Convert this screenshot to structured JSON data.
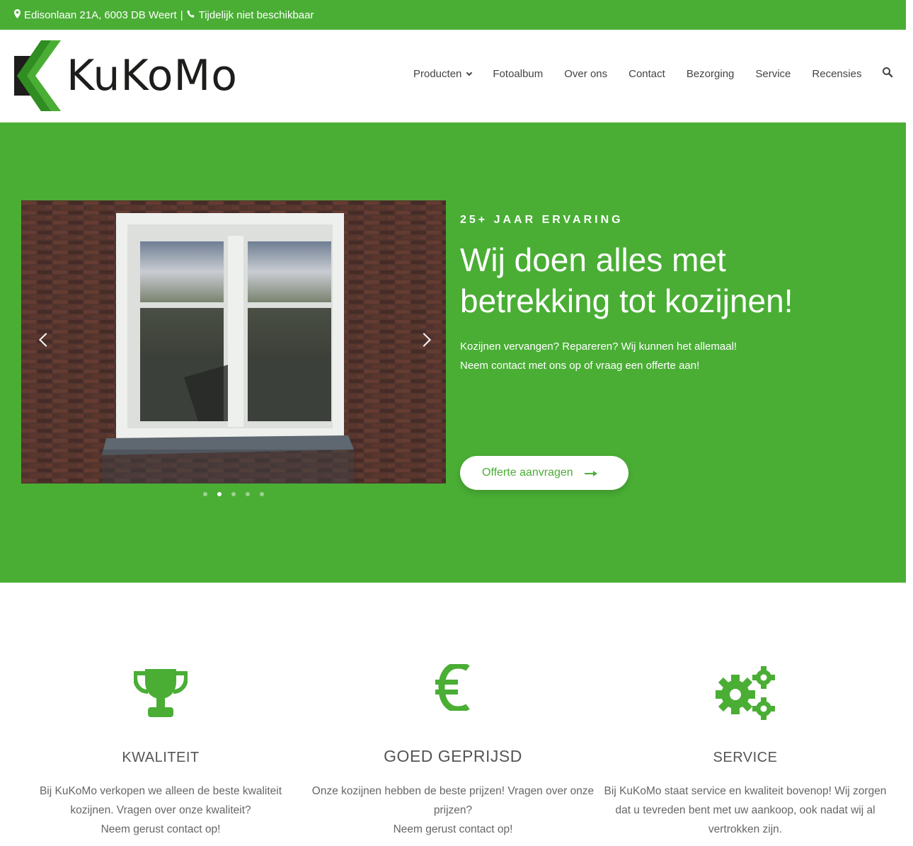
{
  "topbar": {
    "address": "Edisonlaan 21A, 6003 DB Weert",
    "separator": "|",
    "phone": "Tijdelijk niet beschikbaar"
  },
  "logo": {
    "text": "KuKoMo"
  },
  "nav": {
    "items": [
      "Producten",
      "Fotoalbum",
      "Over ons",
      "Contact",
      "Bezorging",
      "Service",
      "Recensies"
    ]
  },
  "hero": {
    "eyebrow": "25+ JAAR ERVARING",
    "headline": "Wij doen alles met betrekking tot kozijnen!",
    "subtext_line1": "Kozijnen vervangen? Repareren? Wij kunnen het allemaal!",
    "subtext_line2": "Neem contact met ons op of vraag een offerte aan!",
    "cta_label": "Offerte aanvragen",
    "slides": 5,
    "active_slide": 2
  },
  "features": [
    {
      "icon": "trophy-icon",
      "title": "KWALITEIT",
      "text": "Bij KuKoMo verkopen we alleen de beste kwaliteit kozijnen. Vragen over onze kwaliteit?",
      "text2": "Neem gerust contact op!"
    },
    {
      "icon": "euro-icon",
      "title": "GOED GEPRIJSD",
      "text": "Onze kozijnen hebben de beste prijzen! Vragen over onze prijzen?",
      "text2": "Neem gerust contact op!"
    },
    {
      "icon": "cogs-icon",
      "title": "SERVICE",
      "text": "Bij KuKoMo staat service en kwaliteit bovenop! Wij zorgen dat u tevreden bent met uw aankoop, ook nadat wij al vertrokken zijn.",
      "text2": ""
    }
  ],
  "colors": {
    "brand_green": "#4aae35",
    "white": "#ffffff",
    "text_dark": "#555555"
  }
}
